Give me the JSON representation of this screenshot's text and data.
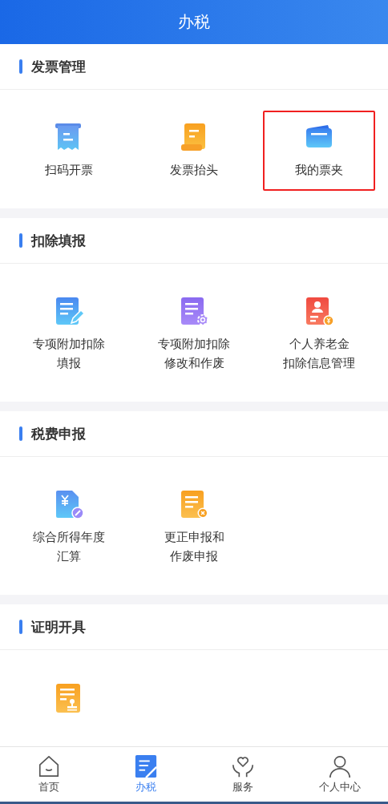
{
  "header": {
    "title": "办税"
  },
  "sections": [
    {
      "title": "发票管理",
      "items": [
        {
          "label": [
            "扫码开票"
          ],
          "highlighted": false
        },
        {
          "label": [
            "发票抬头"
          ],
          "highlighted": false
        },
        {
          "label": [
            "我的票夹"
          ],
          "highlighted": true
        }
      ]
    },
    {
      "title": "扣除填报",
      "items": [
        {
          "label": [
            "专项附加扣除",
            "填报"
          ],
          "highlighted": false
        },
        {
          "label": [
            "专项附加扣除",
            "修改和作废"
          ],
          "highlighted": false
        },
        {
          "label": [
            "个人养老金",
            "扣除信息管理"
          ],
          "highlighted": false
        }
      ]
    },
    {
      "title": "税费申报",
      "items": [
        {
          "label": [
            "综合所得年度",
            "汇算"
          ],
          "highlighted": false
        },
        {
          "label": [
            "更正申报和",
            "作废申报"
          ],
          "highlighted": false
        }
      ]
    },
    {
      "title": "证明开具",
      "items": [
        {
          "highlighted": false
        }
      ]
    }
  ],
  "tabs": [
    {
      "label": "首页",
      "selected": false
    },
    {
      "label": "办税",
      "selected": true
    },
    {
      "label": "服务",
      "selected": false
    },
    {
      "label": "个人中心",
      "selected": false
    }
  ]
}
